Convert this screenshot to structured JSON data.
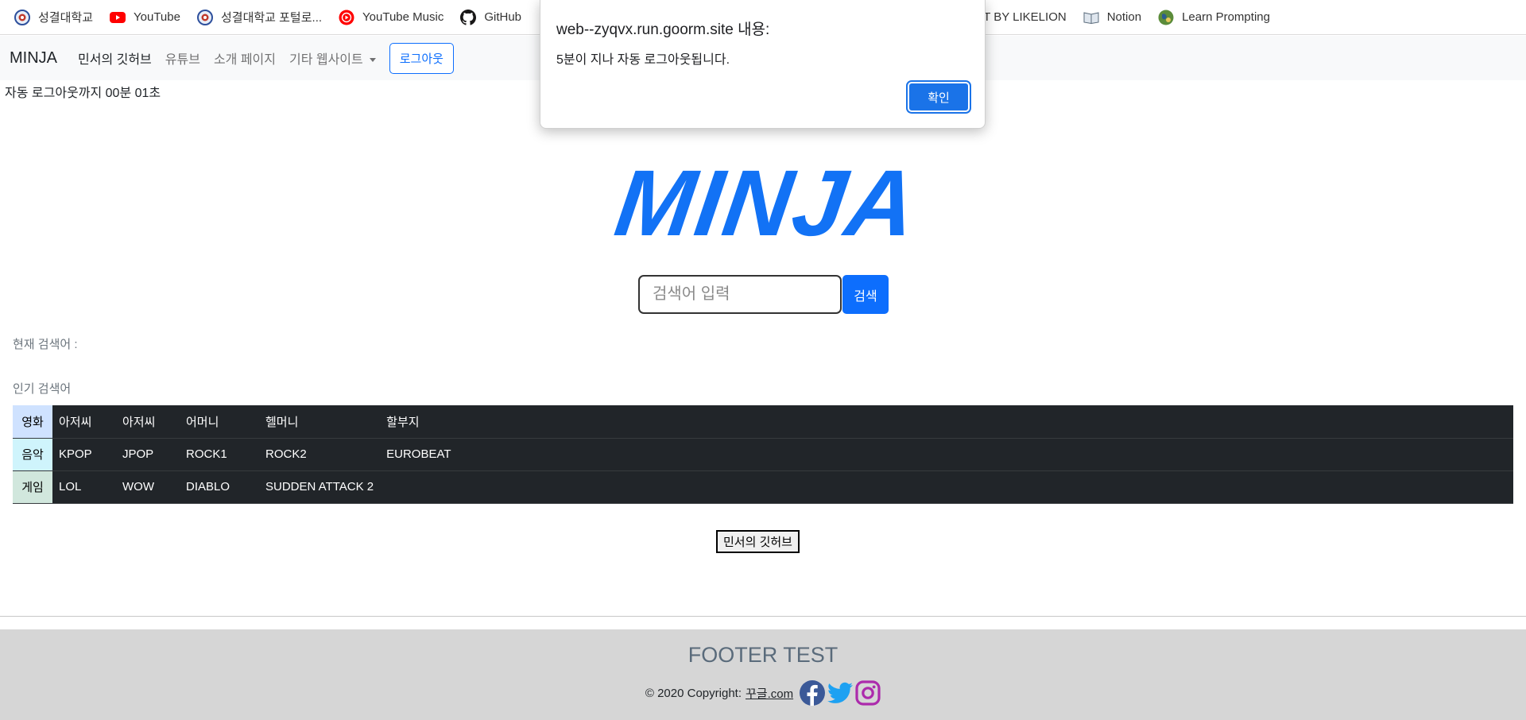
{
  "bookmarks": [
    {
      "label": "성결대학교",
      "icon": "university-seal-icon"
    },
    {
      "label": "YouTube",
      "icon": "youtube-icon"
    },
    {
      "label": "성결대학교 포털로...",
      "icon": "university-seal-icon"
    },
    {
      "label": "YouTube Music",
      "icon": "youtube-music-icon"
    },
    {
      "label": "GitHub",
      "icon": "github-icon"
    },
    {
      "label": "IT BY LIKELION",
      "icon": ""
    },
    {
      "label": "Notion",
      "icon": "book-icon"
    },
    {
      "label": "Learn Prompting",
      "icon": "globe-icon"
    }
  ],
  "navbar": {
    "brand": "MINJA",
    "links": [
      "민서의 깃허브",
      "유튜브",
      "소개 페이지",
      "기타 웹사이트"
    ],
    "logout": "로그아웃"
  },
  "countdown": "자동 로그아웃까지 00분 01초",
  "logo": "MINJA",
  "search": {
    "placeholder": "검색어 입력",
    "button": "검색"
  },
  "current_search_label": "현재 검색어 :",
  "popular_label": "인기 검색어",
  "table": {
    "rows": [
      {
        "header": "영화",
        "cells": [
          "아저씨",
          "아저씨",
          "어머니",
          "헬머니",
          "할부지"
        ]
      },
      {
        "header": "음악",
        "cells": [
          "KPOP",
          "JPOP",
          "ROCK1",
          "ROCK2",
          "EUROBEAT"
        ]
      },
      {
        "header": "게임",
        "cells": [
          "LOL",
          "WOW",
          "DIABLO",
          "SUDDEN ATTACK 2",
          ""
        ]
      }
    ]
  },
  "github_button": "민서의 깃허브",
  "footer": {
    "title": "FOOTER TEST",
    "copyright": "© 2020 Copyright:",
    "link": "꾸글.com",
    "social": [
      "facebook-icon",
      "twitter-icon",
      "instagram-icon"
    ]
  },
  "dialog": {
    "title": "web--zyqvx.run.goorm.site 내용:",
    "message": "5분이 지나 자동 로그아웃됩니다.",
    "ok": "확인"
  },
  "colors": {
    "primary": "#0d6efd",
    "logo": "#1272f5",
    "table_dark": "#212529",
    "footer_bg": "#d6d6d6",
    "facebook": "#3b5998",
    "twitter": "#1da1f2",
    "instagram": "#ac2bac"
  }
}
